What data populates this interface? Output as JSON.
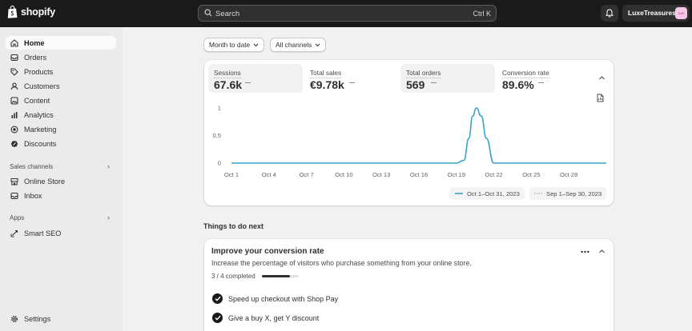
{
  "topbar": {
    "brand": "shopify",
    "search_placeholder": "Search",
    "search_shortcut": "Ctrl K",
    "store_name": "LuxeTreasures",
    "store_avatar": "Lux"
  },
  "sidebar": {
    "items": [
      {
        "label": "Home",
        "icon": "home-icon",
        "active": true
      },
      {
        "label": "Orders",
        "icon": "orders-icon"
      },
      {
        "label": "Products",
        "icon": "products-icon"
      },
      {
        "label": "Customers",
        "icon": "customers-icon"
      },
      {
        "label": "Content",
        "icon": "content-icon"
      },
      {
        "label": "Analytics",
        "icon": "analytics-icon"
      },
      {
        "label": "Marketing",
        "icon": "marketing-icon"
      },
      {
        "label": "Discounts",
        "icon": "discounts-icon"
      }
    ],
    "sales_channels_label": "Sales channels",
    "sales_channels": [
      {
        "label": "Online Store",
        "icon": "store-icon"
      },
      {
        "label": "Inbox",
        "icon": "inbox-icon"
      }
    ],
    "apps_label": "Apps",
    "apps": [
      {
        "label": "Smart SEO",
        "icon": "seo-icon"
      }
    ],
    "settings_label": "Settings"
  },
  "filters": {
    "date_range": "Month to date",
    "channels": "All channels"
  },
  "metrics": [
    {
      "label": "Sessions",
      "value": "67.6k"
    },
    {
      "label": "Total sales",
      "value": "€9.78k"
    },
    {
      "label": "Total orders",
      "value": "569"
    },
    {
      "label": "Conversion rate",
      "value": "89.6%"
    }
  ],
  "chart_data": {
    "type": "line",
    "x_ticks": [
      "Oct 1",
      "Oct 4",
      "Oct 7",
      "Oct 10",
      "Oct 13",
      "Oct 16",
      "Oct 19",
      "Oct 22",
      "Oct 25",
      "Oct 28"
    ],
    "y_ticks": [
      "1",
      "0.5",
      "0"
    ],
    "ylim": [
      0,
      1
    ],
    "xlim": [
      1,
      31
    ],
    "series": [
      {
        "name": "Oct 1–Oct 31, 2023",
        "color": "#34a3c8",
        "style": "solid",
        "x": [
          1,
          19,
          19.6,
          20,
          20.3,
          20.6,
          21,
          21.4,
          22,
          31
        ],
        "y": [
          0,
          0,
          0.05,
          0.45,
          0.85,
          1,
          0.85,
          0.45,
          0,
          0
        ]
      },
      {
        "name": "Sep 1–Sep 30, 2023",
        "color": "#b5b5b5",
        "style": "dotted",
        "x": [],
        "y": []
      }
    ],
    "legend_position": "bottom-right",
    "grid": false
  },
  "things_to_do": {
    "heading": "Things to do next",
    "task": {
      "title": "Improve your conversion rate",
      "description": "Increase the percentage of visitors who purchase something from your online store.",
      "progress_text": "3 / 4 completed",
      "progress": 0.75,
      "steps": [
        {
          "label": "Speed up checkout with Shop Pay",
          "done": true
        },
        {
          "label": "Give a buy X, get Y discount",
          "done": true
        }
      ]
    }
  }
}
